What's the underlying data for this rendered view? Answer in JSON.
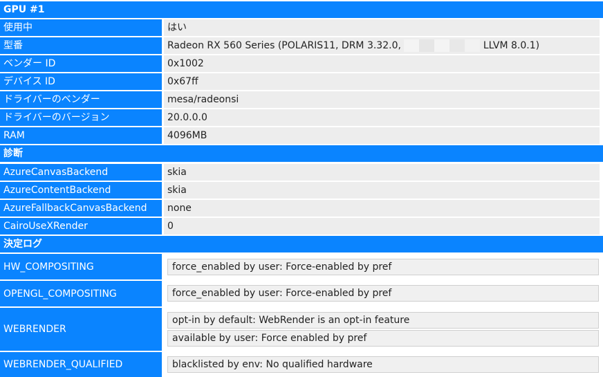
{
  "gpu": {
    "title": "GPU #1",
    "rows": [
      {
        "label": "使用中",
        "value": "はい"
      },
      {
        "label": "型番",
        "value_pre": "Radeon RX 560 Series (POLARIS11, DRM 3.32.0,",
        "value_post": "LLVM 8.0.1)"
      },
      {
        "label": "ベンダー ID",
        "value": "0x1002"
      },
      {
        "label": "デバイス ID",
        "value": "0x67ff"
      },
      {
        "label": "ドライバーのベンダー",
        "value": "mesa/radeonsi"
      },
      {
        "label": "ドライバーのバージョン",
        "value": "20.0.0.0"
      },
      {
        "label": "RAM",
        "value": "4096MB"
      }
    ]
  },
  "diagnostics": {
    "title": "診断",
    "rows": [
      {
        "label": "AzureCanvasBackend",
        "value": "skia"
      },
      {
        "label": "AzureContentBackend",
        "value": "skia"
      },
      {
        "label": "AzureFallbackCanvasBackend",
        "value": "none"
      },
      {
        "label": "CairoUseXRender",
        "value": "0"
      }
    ]
  },
  "decision_log": {
    "title": "決定ログ",
    "rows": [
      {
        "label": "HW_COMPOSITING",
        "entries": [
          "force_enabled by user: Force-enabled by pref"
        ]
      },
      {
        "label": "OPENGL_COMPOSITING",
        "entries": [
          "force_enabled by user: Force-enabled by pref"
        ]
      },
      {
        "label": "WEBRENDER",
        "entries": [
          "opt-in by default: WebRender is an opt-in feature",
          "available by user: Force enabled by pref"
        ]
      },
      {
        "label": "WEBRENDER_QUALIFIED",
        "entries": [
          "blacklisted by env: No qualified hardware"
        ]
      }
    ]
  },
  "colors": {
    "header": "#0a84ff",
    "value_bg": "#ededed"
  }
}
